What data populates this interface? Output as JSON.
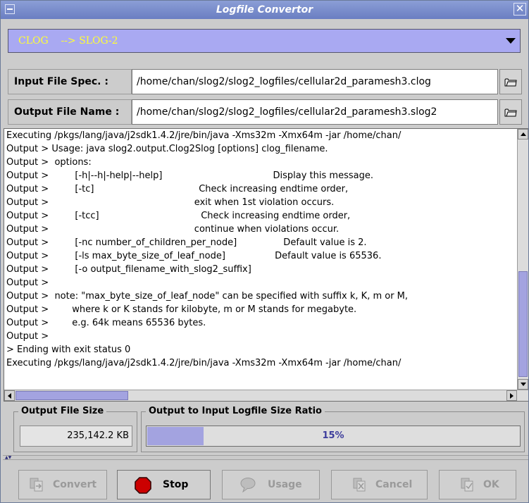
{
  "window": {
    "title": "Logfile Convertor"
  },
  "converter": {
    "selected": "CLOG    --> SLOG-2"
  },
  "input": {
    "label": "Input File Spec. :",
    "value": "/home/chan/slog2/slog2_logfiles/cellular2d_paramesh3.clog"
  },
  "output": {
    "label": "Output File Name :",
    "value": "/home/chan/slog2/slog2_logfiles/cellular2d_paramesh3.slog2"
  },
  "log": {
    "lines": [
      "Executing /pkgs/lang/java/j2sdk1.4.2/jre/bin/java -Xms32m -Xmx64m -jar /home/chan/",
      "Output > Usage: java slog2.output.Clog2Slog [options] clog_filename.",
      "Output >  options:",
      "Output >         [-h|--h|-help|--help]                                      Display this message.",
      "Output >         [-tc]                                    Check increasing endtime order,",
      "Output >                                                  exit when 1st violation occurs.",
      "Output >         [-tcc]                                   Check increasing endtime order,",
      "Output >                                                  continue when violations occur.",
      "Output >         [-nc number_of_children_per_node]                Default value is 2.",
      "Output >         [-ls max_byte_size_of_leaf_node]                 Default value is 65536.",
      "Output >         [-o output_filename_with_slog2_suffix]",
      "Output >",
      "Output >  note: \"max_byte_size_of_leaf_node\" can be specified with suffix k, K, m or M,",
      "Output >        where k or K stands for kilobyte, m or M stands for megabyte.",
      "Output >        e.g. 64k means 65536 bytes.",
      "Output >",
      "> Ending with exit status 0",
      "Executing /pkgs/lang/java/j2sdk1.4.2/jre/bin/java -Xms32m -Xmx64m -jar /home/chan/"
    ]
  },
  "size": {
    "legend": "Output File Size",
    "value": "235,142.2 KB"
  },
  "ratio": {
    "legend": "Output to Input Logfile Size Ratio",
    "label": "15%",
    "fraction": 0.15
  },
  "buttons": {
    "convert": "Convert",
    "stop": "Stop",
    "usage": "Usage",
    "cancel": "Cancel",
    "ok": "OK"
  },
  "colors": {
    "title_bar": "#7b8fcc",
    "accent": "#a3a3e0",
    "combo_text": "#ffff33",
    "stop_red": "#cc0000"
  },
  "icons": {
    "menu": "menu-icon",
    "close": "close-icon",
    "browse": "folder-icon",
    "convert": "convert-icon",
    "stop": "stop-icon",
    "usage": "speech-bubble-icon",
    "cancel": "cancel-icon",
    "ok": "ok-icon"
  }
}
